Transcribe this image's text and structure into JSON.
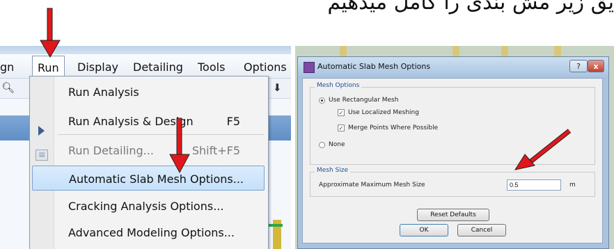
{
  "caption": "یق زیر مش بندی را کامل میدهیم",
  "menubar": {
    "items": [
      "gn",
      "Run",
      "Display",
      "Detailing",
      "Tools",
      "Options"
    ]
  },
  "run_menu": {
    "items": [
      {
        "label": "Run Analysis",
        "shortcut": ""
      },
      {
        "label": "Run Analysis & Design",
        "shortcut": "F5"
      },
      {
        "label": "Run Detailing...",
        "shortcut": "Shift+F5"
      },
      {
        "label": "Automatic Slab Mesh Options...",
        "shortcut": ""
      },
      {
        "label": "Cracking Analysis Options...",
        "shortcut": ""
      },
      {
        "label": "Advanced Modeling Options...",
        "shortcut": ""
      }
    ]
  },
  "dialog": {
    "title": "Automatic Slab Mesh Options",
    "help_glyph": "?",
    "close_glyph": "x",
    "mesh_options": {
      "label": "Mesh Options",
      "use_rectangular": "Use Rectangular Mesh",
      "use_localized": "Use Localized Meshing",
      "merge_points": "Merge Points Where Possible",
      "none": "None"
    },
    "mesh_size": {
      "label": "Mesh Size",
      "field_label": "Approximate Maximum Mesh Size",
      "value": "0.5",
      "unit": "m"
    },
    "reset_label": "Reset Defaults",
    "ok_label": "OK",
    "cancel_label": "Cancel"
  },
  "colors": {
    "arrow": "#e0181b",
    "highlight": "#c4e0fb",
    "group_label": "#1f4f94"
  }
}
